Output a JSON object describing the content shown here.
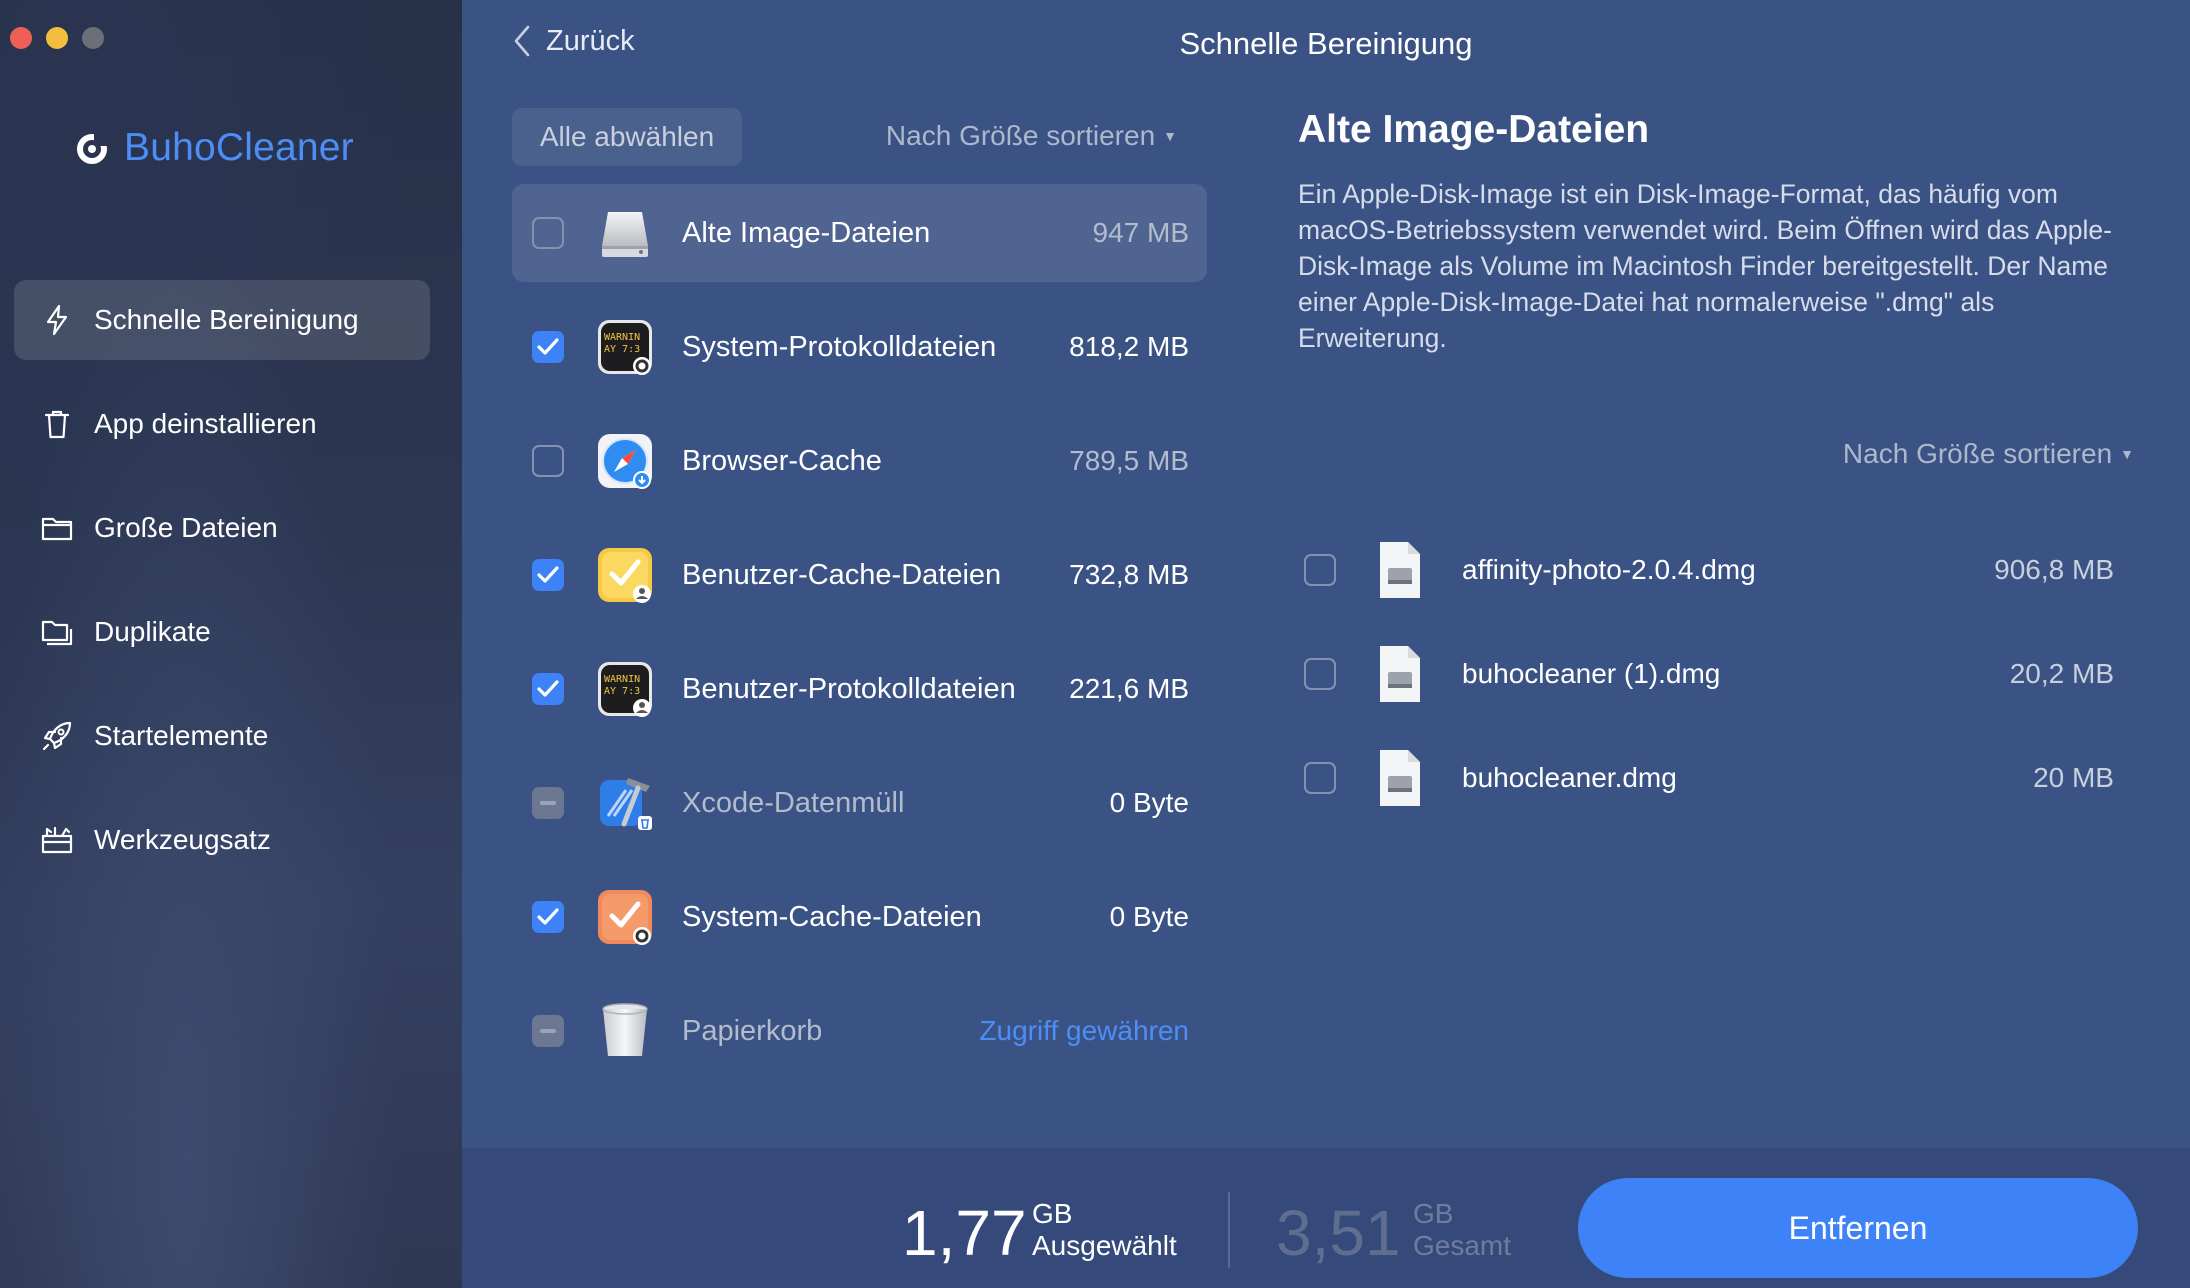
{
  "window": {
    "traffic_lights": [
      "close",
      "minimize",
      "zoom"
    ]
  },
  "brand": {
    "name": "BuhoCleaner",
    "color": "#4c8ef6"
  },
  "sidebar": {
    "items": [
      {
        "label": "Schnelle Bereinigung",
        "icon": "bolt-icon",
        "active": true
      },
      {
        "label": "App deinstallieren",
        "icon": "trash-icon",
        "active": false
      },
      {
        "label": "Große Dateien",
        "icon": "folder-icon",
        "active": false
      },
      {
        "label": "Duplikate",
        "icon": "duplicate-folder-icon",
        "active": false
      },
      {
        "label": "Startelemente",
        "icon": "rocket-icon",
        "active": false
      },
      {
        "label": "Werkzeugsatz",
        "icon": "toolbox-icon",
        "active": false
      }
    ]
  },
  "header": {
    "back_label": "Zurück",
    "title": "Schnelle Bereinigung"
  },
  "controls": {
    "deselect_all": "Alle abwählen",
    "sort_label": "Nach Größe sortieren"
  },
  "categories": [
    {
      "name": "Alte Image-Dateien",
      "size": "947 MB",
      "state": "unchecked",
      "icon": "disk-drive-icon",
      "selected": true
    },
    {
      "name": "System-Protokolldateien",
      "size": "818,2 MB",
      "state": "checked",
      "icon": "console-gear-icon",
      "selected": false
    },
    {
      "name": "Browser-Cache",
      "size": "789,5 MB",
      "state": "unchecked",
      "icon": "safari-compass-icon",
      "selected": false
    },
    {
      "name": "Benutzer-Cache-Dateien",
      "size": "732,8 MB",
      "state": "checked",
      "icon": "user-cache-icon",
      "selected": false
    },
    {
      "name": "Benutzer-Protokolldateien",
      "size": "221,6 MB",
      "state": "checked",
      "icon": "console-user-icon",
      "selected": false
    },
    {
      "name": "Xcode-Datenmüll",
      "size": "0 Byte",
      "state": "mixed",
      "icon": "xcode-hammer-icon",
      "selected": false,
      "dim": true
    },
    {
      "name": "System-Cache-Dateien",
      "size": "0 Byte",
      "state": "checked",
      "icon": "system-cache-icon",
      "selected": false
    },
    {
      "name": "Papierkorb",
      "size": "Zugriff gewähren",
      "state": "mixed",
      "icon": "trash-bin-icon",
      "selected": false,
      "dim": true,
      "link": true
    }
  ],
  "detail": {
    "title": "Alte Image-Dateien",
    "description": "Ein Apple-Disk-Image ist ein Disk-Image-Format, das häufig vom macOS-Betriebssystem verwendet wird. Beim Öffnen wird das Apple-Disk-Image als Volume im Macintosh Finder bereitgestellt. Der Name einer Apple-Disk-Image-Datei hat normalerweise \".dmg\" als Erweiterung.",
    "sort_label": "Nach Größe sortieren",
    "files": [
      {
        "name": "affinity-photo-2.0.4.dmg",
        "size": "906,8 MB",
        "state": "unchecked"
      },
      {
        "name": "buhocleaner (1).dmg",
        "size": "20,2 MB",
        "state": "unchecked"
      },
      {
        "name": "buhocleaner.dmg",
        "size": "20 MB",
        "state": "unchecked"
      }
    ]
  },
  "footer": {
    "selected_value": "1,77",
    "selected_unit": "GB",
    "selected_label": "Ausgewählt",
    "total_value": "3,51",
    "total_unit": "GB",
    "total_label": "Gesamt",
    "remove_label": "Entfernen",
    "accent": "#3d82f6"
  }
}
